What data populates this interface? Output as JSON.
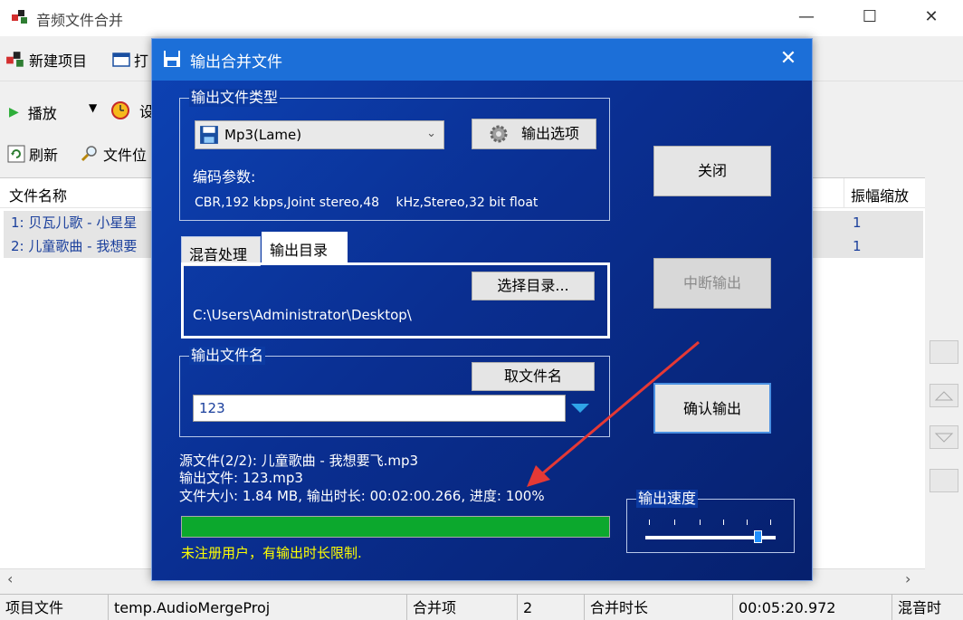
{
  "window": {
    "title": "音频文件合并",
    "minimize": "—",
    "maximize": "☐",
    "close": "✕"
  },
  "toolbar": {
    "new_project": "新建项目",
    "open": "打",
    "play": "播放",
    "settings_partial": "设",
    "refresh": "刷新",
    "file_location": "文件位"
  },
  "list": {
    "col_filename": "文件名称",
    "col_amplitude": "振幅缩放",
    "rows": [
      {
        "name": "1: 贝瓦儿歌 - 小星星",
        "amp": "1"
      },
      {
        "name": "2: 儿童歌曲 - 我想要",
        "amp": "1"
      }
    ]
  },
  "statusbar": {
    "project_label": "项目文件",
    "project_value": "temp.AudioMergeProj",
    "items_label": "合并项",
    "items_value": "2",
    "duration_label": "合并时长",
    "duration_value": "00:05:20.972",
    "mix_label": "混音时"
  },
  "dialog": {
    "title": "输出合并文件",
    "output_type_group": "输出文件类型",
    "format_selected": "Mp3(Lame)",
    "output_options_button": "输出选项",
    "encoding_label": "编码参数:",
    "encoding_value": "CBR,192 kbps,Joint stereo,48　 kHz,Stereo,32 bit float",
    "tabs": [
      "混音处理",
      "输出目录"
    ],
    "choose_dir_button": "选择目录...",
    "output_dir": "C:\\Users\\Administrator\\Desktop\\",
    "filename_group": "输出文件名",
    "get_filename_button": "取文件名",
    "filename_value": "123",
    "close_button": "关闭",
    "abort_button": "中断输出",
    "confirm_button": "确认输出",
    "source_file": "源文件(2/2): 儿童歌曲 - 我想要飞.mp3",
    "output_file": "输出文件: 123.mp3",
    "file_info": "文件大小: 1.84 MB, 输出时长: 00:02:00.266, 进度: 100%",
    "progress": 1.0,
    "warning": "未注册用户，有输出时长限制.",
    "speed_group": "输出速度",
    "speed_level": 0.85
  },
  "colors": {
    "dialog_bg": "#0b3aa2",
    "dialog_titlebar": "#1c6fd8",
    "progress": "#0ca82d",
    "warning": "#ffff00",
    "annotation_arrow": "#e53935"
  }
}
